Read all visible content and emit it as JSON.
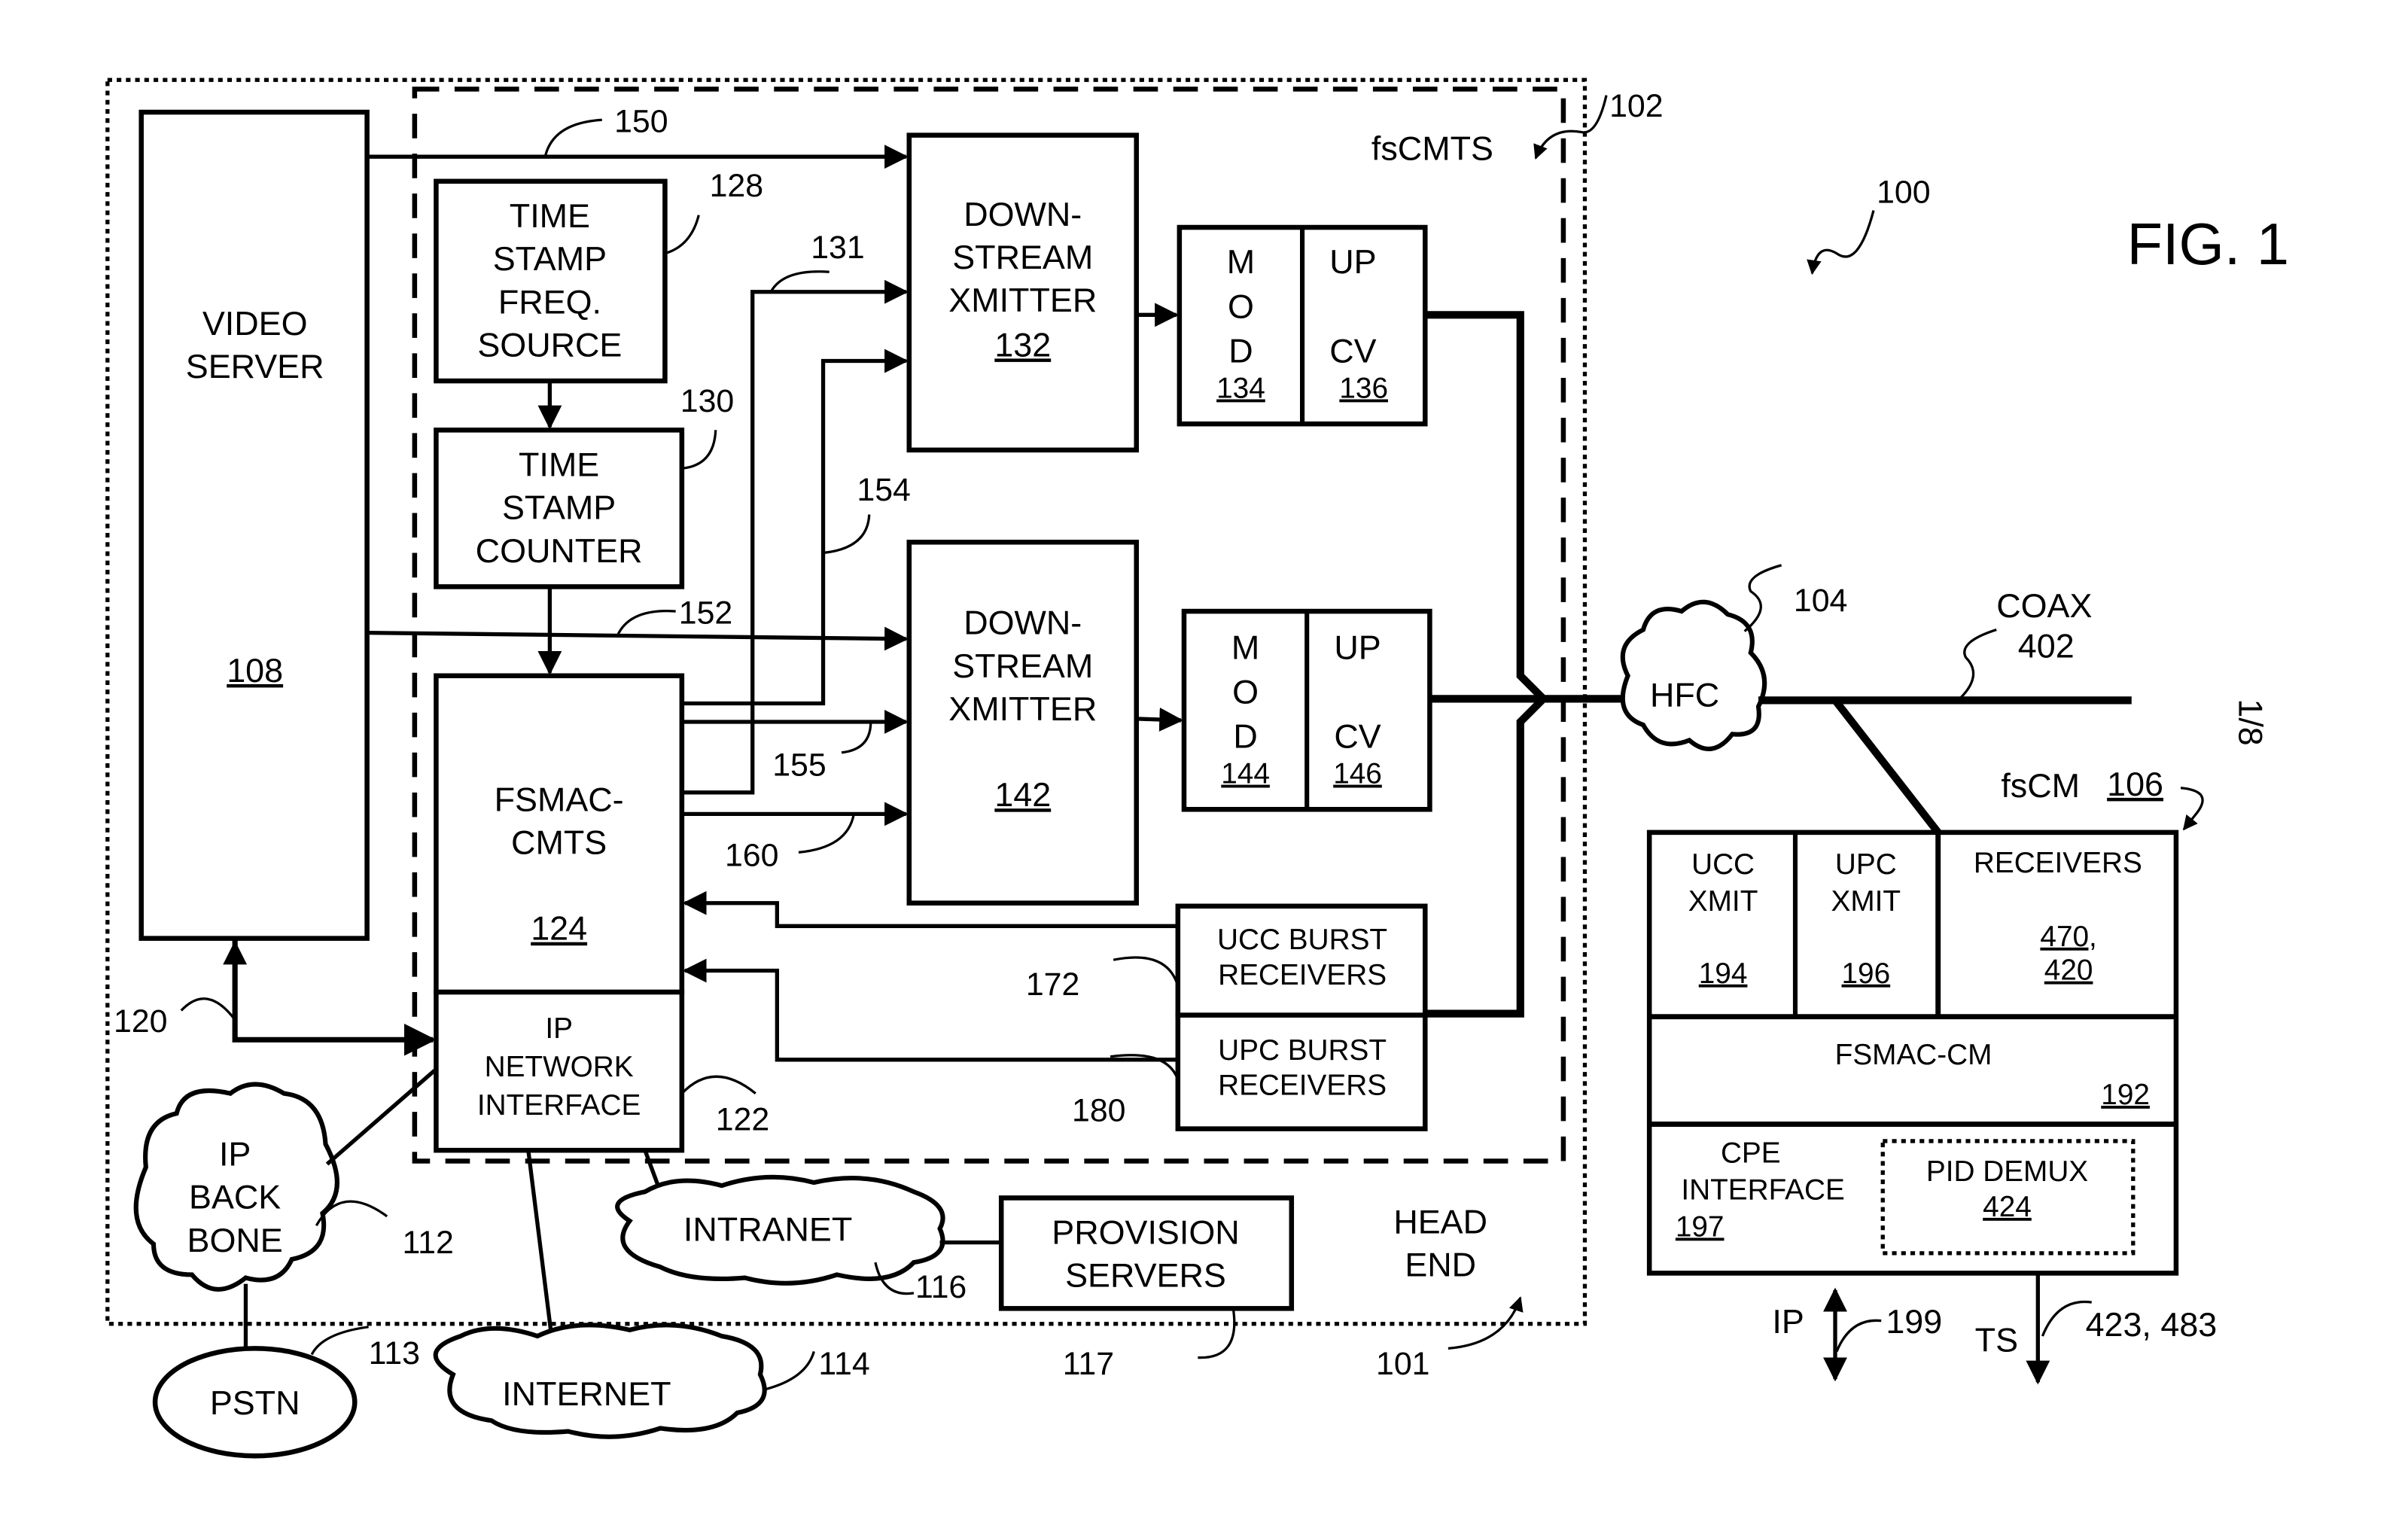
{
  "figure": {
    "title": "FIG. 1",
    "sheet": "1/8",
    "system_ref": "100"
  },
  "head_end": {
    "label_line1": "HEAD",
    "label_line2": "END",
    "ref": "101"
  },
  "fscmts": {
    "label": "fsCMTS",
    "ref": "102"
  },
  "video_server": {
    "line1": "VIDEO",
    "line2": "SERVER",
    "ref": "108"
  },
  "ts_freq_source": {
    "line1": "TIME",
    "line2": "STAMP",
    "line3": "FREQ.",
    "line4": "SOURCE",
    "ref": "128"
  },
  "ts_counter": {
    "line1": "TIME",
    "line2": "STAMP",
    "line3": "COUNTER",
    "ref": "130"
  },
  "fsmac_cmts": {
    "line1": "FSMAC-",
    "line2": "CMTS",
    "ref": "124"
  },
  "ip_net_iface": {
    "line1": "IP",
    "line2": "NETWORK",
    "line3": "INTERFACE",
    "ref": "122"
  },
  "ds_xmitter_1": {
    "line1": "DOWN-",
    "line2": "STREAM",
    "line3": "XMITTER",
    "ref": "132"
  },
  "ds_xmitter_2": {
    "line1": "DOWN-",
    "line2": "STREAM",
    "line3": "XMITTER",
    "ref": "142"
  },
  "mod_1": {
    "letters": [
      "M",
      "O",
      "D"
    ],
    "ref": "134"
  },
  "upcv_1": {
    "line1": "UP",
    "line2": "CV",
    "ref": "136"
  },
  "mod_2": {
    "letters": [
      "M",
      "O",
      "D"
    ],
    "ref": "144"
  },
  "upcv_2": {
    "line1": "UP",
    "line2": "CV",
    "ref": "146"
  },
  "ucc_burst": {
    "line1": "UCC BURST",
    "line2": "RECEIVERS",
    "ref": "172"
  },
  "upc_burst": {
    "line1": "UPC BURST",
    "line2": "RECEIVERS",
    "ref": "180"
  },
  "links": {
    "l150": "150",
    "l152": "152",
    "l131": "131",
    "l154": "154",
    "l155": "155",
    "l160": "160",
    "l120": "120"
  },
  "clouds": {
    "ip_backbone": {
      "line1": "IP",
      "line2": "BACK",
      "line3": "BONE",
      "ref": "112"
    },
    "internet": {
      "label": "INTERNET",
      "ref": "114"
    },
    "intranet": {
      "label": "INTRANET",
      "ref": "116"
    },
    "hfc": {
      "label": "HFC",
      "ref": "104"
    }
  },
  "pstn": {
    "label": "PSTN",
    "ref": "113"
  },
  "provision_servers": {
    "line1": "PROVISION",
    "line2": "SERVERS",
    "ref": "117"
  },
  "coax": {
    "line1": "COAX",
    "line2": "402"
  },
  "fscm": {
    "label": "fsCM",
    "ref": "106",
    "ucc_xmit": {
      "line1": "UCC",
      "line2": "XMIT",
      "ref": "194"
    },
    "upc_xmit": {
      "line1": "UPC",
      "line2": "XMIT",
      "ref": "196"
    },
    "receivers": {
      "line1": "RECEIVERS",
      "ref1": "470,",
      "ref2": "420"
    },
    "fsmac_cm": {
      "label": "FSMAC-CM",
      "ref": "192"
    },
    "cpe_interface": {
      "line1": "CPE",
      "line2": "INTERFACE",
      "ref": "197"
    },
    "pid_demux": {
      "label": "PID DEMUX",
      "ref": "424"
    },
    "ip_out": {
      "label": "IP",
      "ref": "199"
    },
    "ts_out": {
      "label": "TS",
      "ref": "423, 483"
    }
  }
}
